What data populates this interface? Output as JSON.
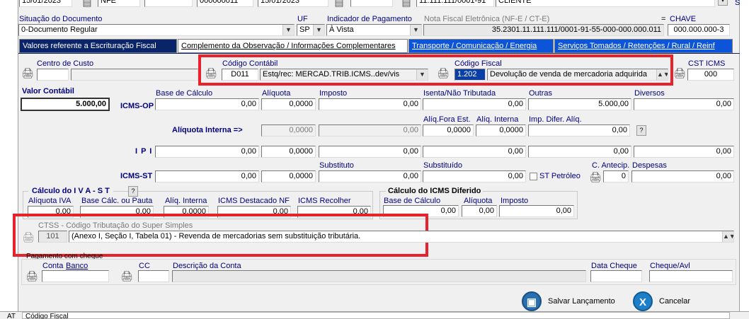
{
  "top_row": {
    "date1": "15/01/2023",
    "modelo": "NFE",
    "numero": "000000011",
    "date2": "15/01/2023",
    "cnpj": "11.111.111/0001-91",
    "tipo": "CLIENTE",
    "right_mark": "S"
  },
  "doc": {
    "situacao_label": "Situação do Documento",
    "situacao_value": "0-Documento Regular",
    "uf_label": "UF",
    "uf_value": "SP",
    "pagamento_label": "Indicador de Pagamento",
    "pagamento_value": "À Vista",
    "nfe_label": "Nota Fiscal Eletrônica (NF-E / CT-E)",
    "nfe_value": "35.2301.11.111.111/0001-91-55-000-000.000.011",
    "eq": "=",
    "chave_label": "CHAVE",
    "chave_value": "000.000.000-3"
  },
  "tabs": [
    {
      "label": "Valores referente a Escrituração Fiscal"
    },
    {
      "label": "Complemento da Observação / Informações Complementares"
    },
    {
      "label": "Transporte / Comunicação / Energia"
    },
    {
      "label": "Serviços Tomados / Retenções / Rural / Reinf"
    }
  ],
  "row1": {
    "centro_label": "Centro de Custo",
    "contabil_label": "Código Contábil",
    "contabil_code": "D011",
    "contabil_desc": "Estq/rec: MERCAD.TRIB.ICMS..dev/vis",
    "fiscal_label": "Código Fiscal",
    "fiscal_code": "1.202",
    "fiscal_desc": "Devolução de venda de mercadoria adquirida",
    "cst_label": "CST ICMS",
    "cst_value": "000"
  },
  "icms_op": {
    "valor_contabil_label": "Valor Contábil",
    "valor_contabil": "5.000,00",
    "label": "ICMS-OP",
    "base_label": "Base de Cálculo",
    "base": "0,00",
    "aliquota_label": "Alíquota",
    "aliquota": "0,0000",
    "imposto_label": "Imposto",
    "imposto": "0,00",
    "isenta_label": "Isenta/Não Tributada",
    "isenta": "0,00",
    "outras_label": "Outras",
    "outras": "5.000,00",
    "diversos_label": "Diversos",
    "diversos": "0,00"
  },
  "aliq_interna": {
    "label": "Alíquota Interna =>",
    "v1": "0,0000",
    "v2": "0,00",
    "fora_label": "Alíq.Fora Est.",
    "fora": "0,0000",
    "interna_label": "Alíq. Interna",
    "interna": "0,0000",
    "difer_label": "Imp. Difer. Alíq.",
    "difer": "0,00",
    "help": "?"
  },
  "ipi": {
    "label": "I P I",
    "v1": "0,00",
    "v2": "0,0000",
    "v3": "0,00",
    "v4": "0,00",
    "v5": "0,00",
    "v6": "0,00"
  },
  "icms_st": {
    "label": "ICMS-ST",
    "v1": "0,00",
    "v2": "0,0000",
    "substituto_label": "Substituto",
    "substituto": "0,00",
    "substituido_label": "Substituído",
    "substituido": "0,00",
    "petroleo_label": "ST Petróleo",
    "antecip_label": "C. Antecip.",
    "antecip": "0",
    "despesas_label": "Despesas",
    "despesas": "0,00"
  },
  "iva": {
    "title": "Cálculo  do  I V A - S T",
    "help": "?",
    "aliq_label": "Alíquota IVA",
    "aliq": "0,00",
    "base_label": "Base Cálc. ou Pauta",
    "base": "0,00",
    "interna_label": "Alíq. Interna",
    "interna": "0,0000",
    "destacado_label": "ICMS Destacado NF",
    "destacado": "0,00",
    "recolher_label": "ICMS Recolher",
    "recolher": "0,00"
  },
  "diferido": {
    "title": "Cálculo do ICMS Diferido",
    "base_label": "Base de Cálculo",
    "base": "0,00",
    "aliq_label": "Alíquota",
    "aliq": "0,00",
    "imposto_label": "Imposto",
    "imposto": "0,00"
  },
  "ctss": {
    "label": "CTSS - Código Tributação do Super Simples",
    "code": "101",
    "desc": "(Anexo I, Seção I, Tabela 01) - Revenda de mercadorias sem substituição tributária."
  },
  "cheque": {
    "group_label": "Pagamento com cheque",
    "conta_label": "Conta",
    "banco_label": "Banco",
    "cc_label": "CC",
    "descricao_label": "Descrição da Conta",
    "data_label": "Data Cheque",
    "avl_label": "Cheque/Avl"
  },
  "buttons": {
    "save": "Salvar Lançamento",
    "cancel": "Cancelar"
  },
  "status": {
    "left": "AT",
    "text": "Código Fiscal"
  },
  "colors": {
    "active_tab": "#0a246a",
    "tab_blue": "#0c55d8",
    "highlight": "#e8222c",
    "label_blue": "#00007f"
  }
}
